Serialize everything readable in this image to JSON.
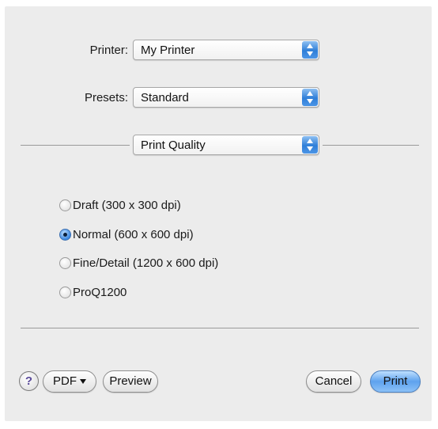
{
  "printer": {
    "label": "Printer:",
    "value": "My Printer"
  },
  "presets": {
    "label": "Presets:",
    "value": "Standard"
  },
  "section": {
    "value": "Print Quality"
  },
  "quality_options": [
    {
      "label": "Draft (300 x 300 dpi)",
      "selected": false
    },
    {
      "label": "Normal (600 x 600 dpi)",
      "selected": true
    },
    {
      "label": "Fine/Detail (1200 x 600 dpi)",
      "selected": false
    },
    {
      "label": "ProQ1200",
      "selected": false
    }
  ],
  "footer": {
    "help_label": "?",
    "pdf_label": "PDF",
    "preview_label": "Preview",
    "cancel_label": "Cancel",
    "print_label": "Print"
  }
}
